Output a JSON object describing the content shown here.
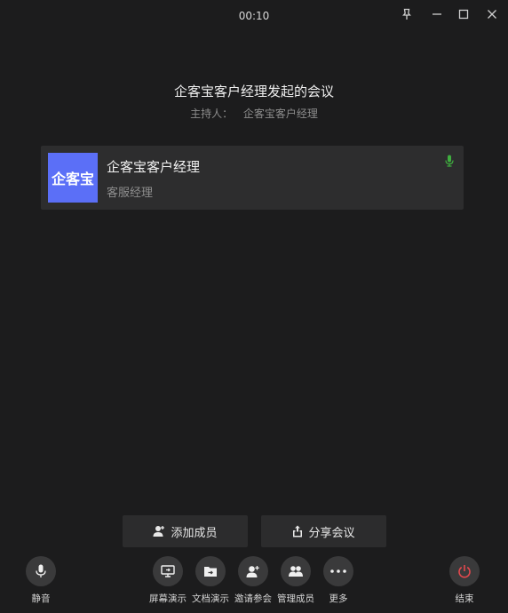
{
  "timer": "00:10",
  "window_controls": [
    "pin-icon",
    "minimize-icon",
    "maximize-icon",
    "close-icon"
  ],
  "meeting": {
    "title": "企客宝客户经理发起的会议",
    "host_label": "主持人：",
    "host_name": "企客宝客户经理"
  },
  "members": [
    {
      "avatar_text": "企客宝",
      "name": "企客宝客户经理",
      "role": "客服经理",
      "mic_icon": "mic-active-icon"
    }
  ],
  "actions": {
    "add_member": "添加成员",
    "share_meeting": "分享会议"
  },
  "toolbar": {
    "mute": "静音",
    "screen_share": "屏幕演示",
    "doc_share": "文档演示",
    "invite": "邀请参会",
    "manage_members": "管理成员",
    "more": "更多",
    "end": "结束"
  },
  "colors": {
    "background": "#1c1c1d",
    "card": "#2d2d2e",
    "avatar": "#5b6ff7",
    "mic_active": "#3fae3f",
    "end_red": "#e5484d"
  }
}
